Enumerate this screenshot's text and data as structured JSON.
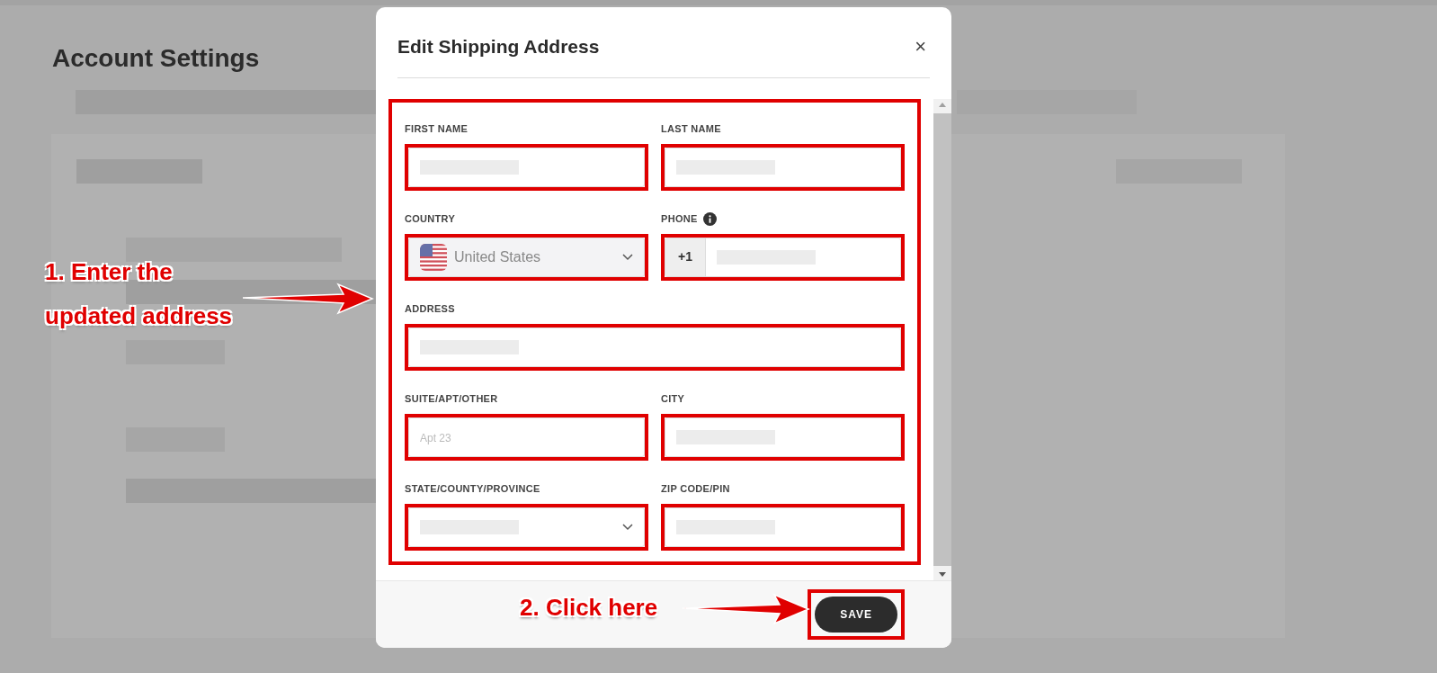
{
  "page": {
    "title": "Account Settings"
  },
  "modal": {
    "title": "Edit Shipping Address",
    "close": "×",
    "fields": [
      {
        "label": "FIRST NAME",
        "kind": "text",
        "redacted": true
      },
      {
        "label": "LAST NAME",
        "kind": "text",
        "redacted": true
      },
      {
        "label": "COUNTRY",
        "kind": "country",
        "value": "United States"
      },
      {
        "label": "PHONE",
        "kind": "phone",
        "prefix": "+1",
        "info": true,
        "redacted": true
      },
      {
        "label": "ADDRESS",
        "kind": "text",
        "wide": true,
        "redacted": true
      },
      {
        "label": "SUITE/APT/OTHER",
        "kind": "text",
        "placeholder": "Apt 23"
      },
      {
        "label": "CITY",
        "kind": "text",
        "redacted": true
      },
      {
        "label": "STATE/COUNTY/PROVINCE",
        "kind": "select",
        "redacted": true
      },
      {
        "label": "ZIP CODE/PIN",
        "kind": "text",
        "redacted": true
      }
    ],
    "save": "SAVE"
  },
  "annotations": [
    {
      "kind": "left",
      "text": "1. Enter the updated address"
    },
    {
      "kind": "footer",
      "text": "2. Click here"
    }
  ]
}
